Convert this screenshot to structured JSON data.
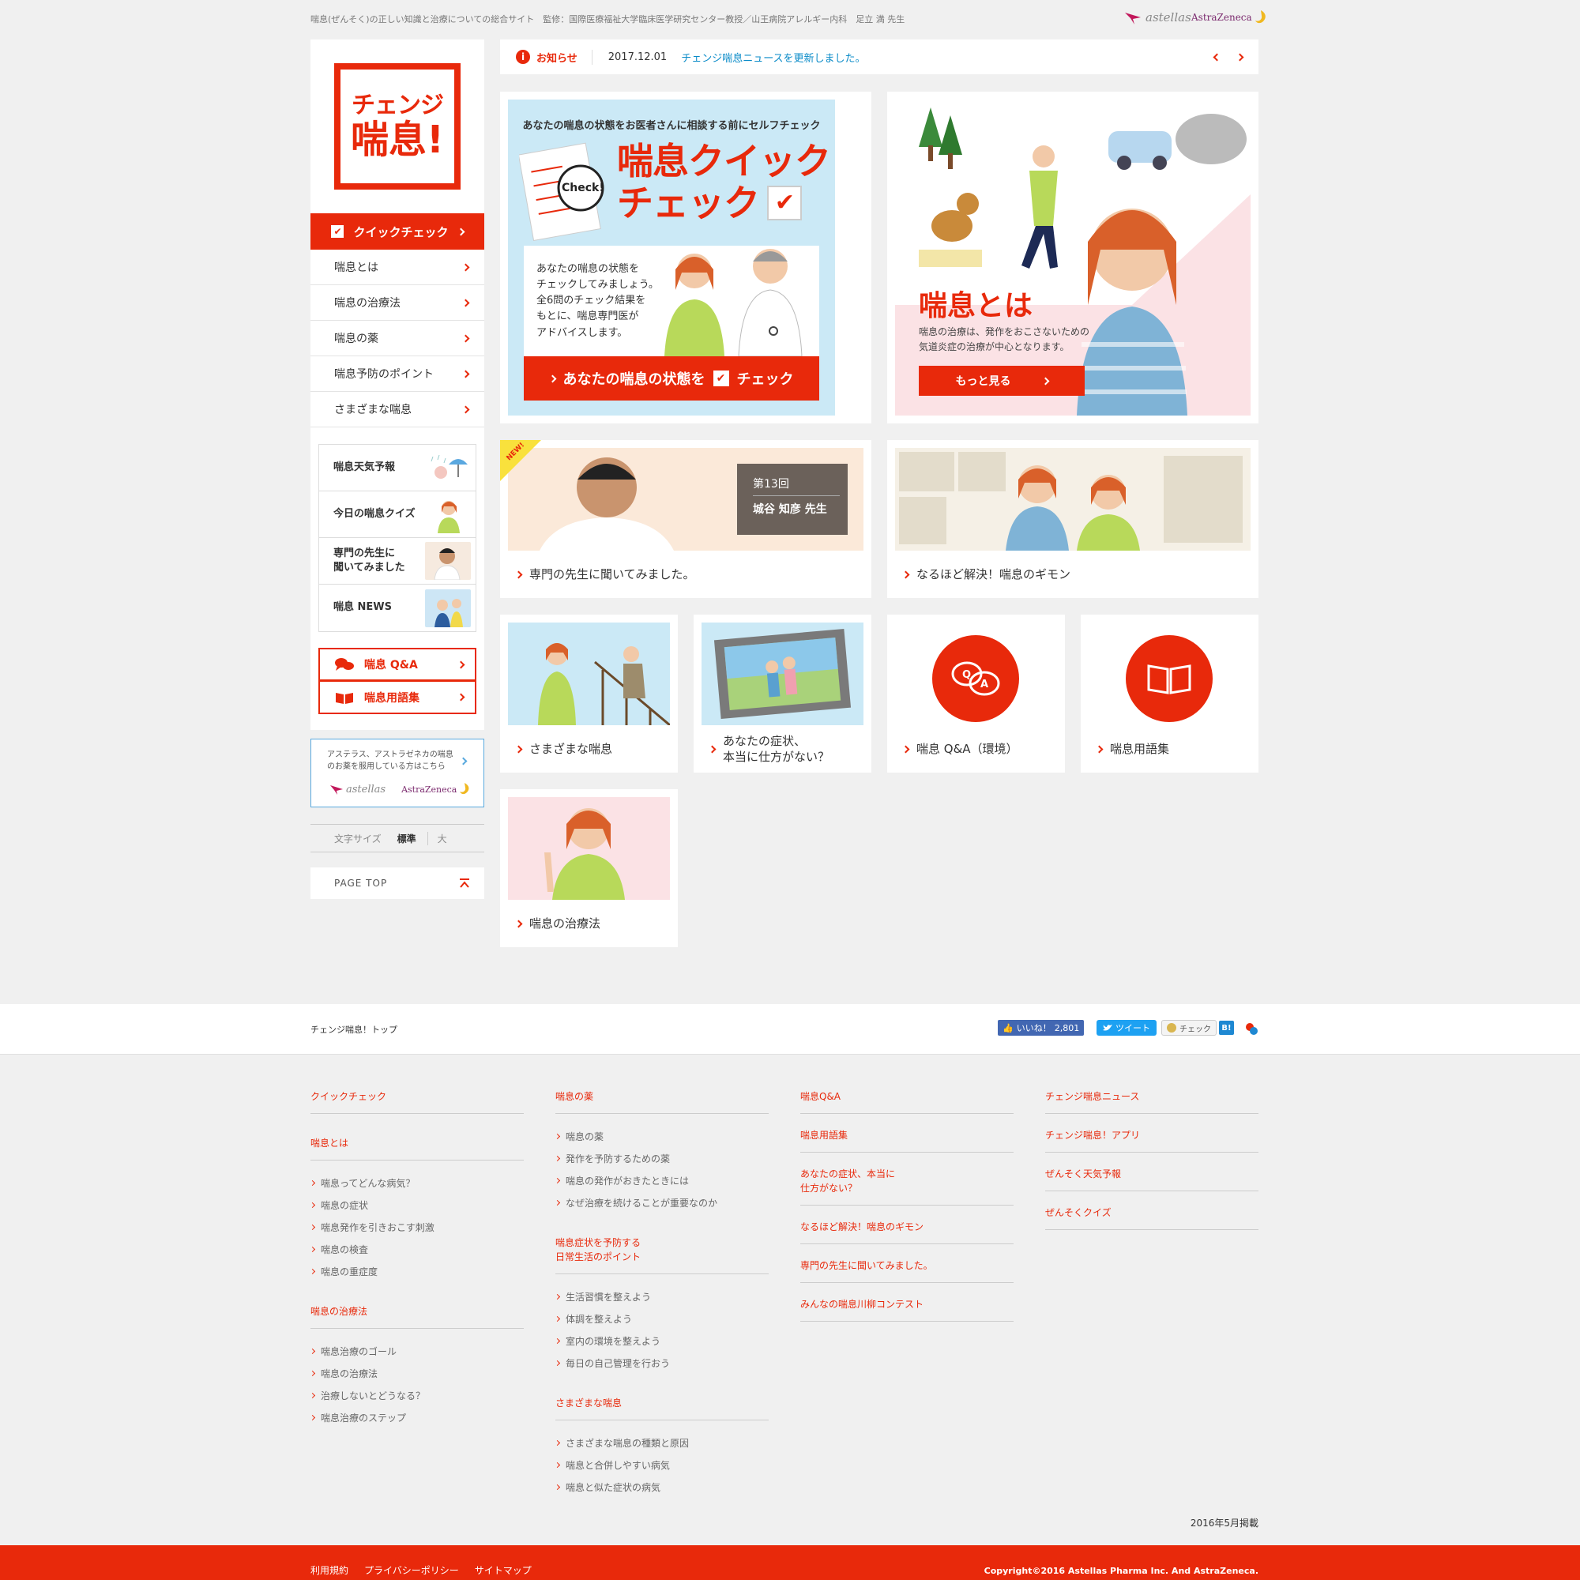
{
  "header": {
    "tagline": "喘息(ぜんそく)の正しい知識と治療についての総合サイト　監修：国際医療福祉大学臨床医学研究センター教授／山王病院アレルギー内科　足立 満 先生",
    "logo_astellas": "astellas",
    "logo_az": "AstraZeneca"
  },
  "brand": {
    "line1": "チェンジ",
    "line2": "喘息!"
  },
  "sidebar": {
    "quick_check": "クイックチェック",
    "nav": [
      "喘息とは",
      "喘息の治療法",
      "喘息の薬",
      "喘息予防のポイント",
      "さまざまな喘息"
    ],
    "box": [
      "喘息天気予報",
      "今日の喘息クイズ",
      "専門の先生に\n聞いてみました",
      "喘息 NEWS"
    ],
    "qa": "喘息 Q&A",
    "glossary": "喘息用語集",
    "partner_text": "アステラス、アストラゼネカの喘息\nのお薬を服用している方はこちら",
    "font_size_label": "文字サイズ",
    "font_standard": "標準",
    "font_large": "大",
    "page_top": "PAGE TOP"
  },
  "news": {
    "label": "お知らせ",
    "date": "2017.12.01",
    "text": "チェンジ喘息ニュースを更新しました。"
  },
  "hero_check": {
    "sub": "あなたの喘息の状態をお医者さんに相談する前にセルフチェック",
    "title1": "喘息クイック",
    "title2": "チェック",
    "check_badge": "Check!",
    "desc": "あなたの喘息の状態を\nチェックしてみましょう。\n全6問のチェック結果を\nもとに、喘息専門医が\nアドバイスします。",
    "button_pre": "あなたの喘息の状態を",
    "button_post": "チェック"
  },
  "hero_about": {
    "title": "喘息とは",
    "desc": "喘息の治療は、発作をおこさないための\n気道炎症の治療が中心となります。",
    "button": "もっと見る"
  },
  "cards": {
    "expert_label": "専門の先生に聞いてみました。",
    "expert_badge": "NEW!",
    "expert_no": "第13回",
    "expert_name": "城谷 知彦 先生",
    "faq_label": "なるほど解決！喘息のギモン",
    "various_label": "さまざまな喘息",
    "symptom_label": "あなたの症状、\n本当に仕方がない？",
    "qa_label": "喘息 Q&A（環境）",
    "glossary_label": "喘息用語集",
    "treatment_label": "喘息の治療法"
  },
  "share": {
    "top_link": "チェンジ喘息！トップ",
    "like": "いいね！",
    "like_count": "2,801",
    "tweet": "ツイート",
    "check": "チェック",
    "hatena": "B!"
  },
  "footer": {
    "col1": [
      {
        "head": "クイックチェック",
        "items": []
      },
      {
        "head": "喘息とは",
        "items": [
          "喘息ってどんな病気？",
          "喘息の症状",
          "喘息発作を引きおこす刺激",
          "喘息の検査",
          "喘息の重症度"
        ]
      },
      {
        "head": "喘息の治療法",
        "items": [
          "喘息治療のゴール",
          "喘息の治療法",
          "治療しないとどうなる？",
          "喘息治療のステップ"
        ]
      }
    ],
    "col2": [
      {
        "head": "喘息の薬",
        "items": [
          "喘息の薬",
          "発作を予防するための薬",
          "喘息の発作がおきたときには",
          "なぜ治療を続けることが重要なのか"
        ]
      },
      {
        "head": "喘息症状を予防する\n日常生活のポイント",
        "items": [
          "生活習慣を整えよう",
          "体調を整えよう",
          "室内の環境を整えよう",
          "毎日の自己管理を行おう"
        ]
      },
      {
        "head": "さまざまな喘息",
        "items": [
          "さまざまな喘息の種類と原因",
          "喘息と合併しやすい病気",
          "喘息と似た症状の病気"
        ]
      }
    ],
    "col3": [
      {
        "head": "喘息Q&A",
        "items": []
      },
      {
        "head": "喘息用語集",
        "items": []
      },
      {
        "head": "あなたの症状、本当に\n仕方がない？",
        "items": []
      },
      {
        "head": "なるほど解決！喘息のギモン",
        "items": []
      },
      {
        "head": "専門の先生に聞いてみました。",
        "items": []
      },
      {
        "head": "みんなの喘息川柳コンテスト",
        "items": []
      }
    ],
    "col4": [
      {
        "head": "チェンジ喘息ニュース",
        "items": []
      },
      {
        "head": "チェンジ喘息！アプリ",
        "items": []
      },
      {
        "head": "ぜんそく天気予報",
        "items": []
      },
      {
        "head": "ぜんそくクイズ",
        "items": []
      }
    ],
    "published": "2016年5月掲載",
    "links": [
      "利用規約",
      "プライバシーポリシー",
      "サイトマップ"
    ],
    "copyright": "Copyright©2016 Astellas Pharma Inc. And AstraZeneca."
  },
  "colors": {
    "accent": "#e8290b",
    "link": "#0a8bc8",
    "sky": "#cbe9f6",
    "pink": "#fbe2e5"
  }
}
